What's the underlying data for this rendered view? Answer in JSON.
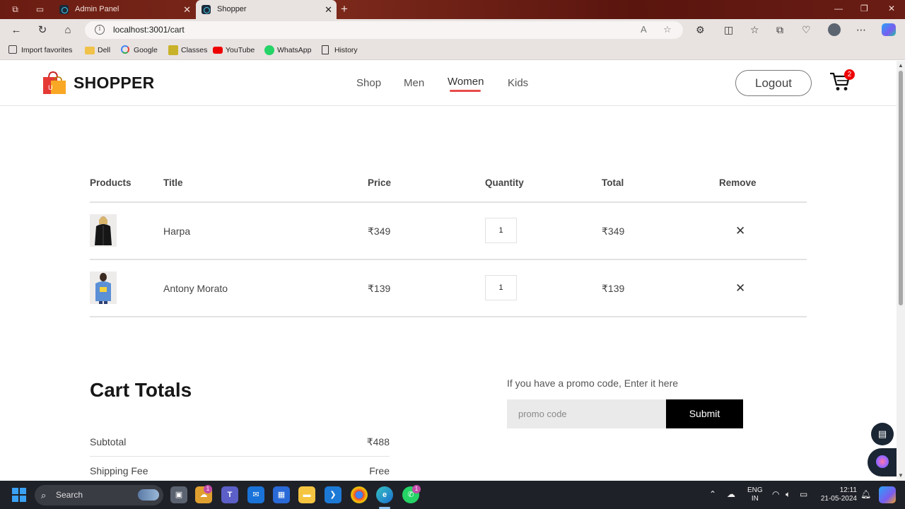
{
  "browser": {
    "tabs": [
      {
        "label": "Admin Panel",
        "active": false
      },
      {
        "label": "Shopper",
        "active": true
      }
    ],
    "url": "localhost:3001/cart",
    "bookmarks": [
      "Import favorites",
      "Dell",
      "Google",
      "Classes",
      "YouTube",
      "WhatsApp",
      "History"
    ]
  },
  "site": {
    "brand": "SHOPPER",
    "menu": [
      "Shop",
      "Men",
      "Women",
      "Kids"
    ],
    "active_menu": "Women",
    "logout_label": "Logout",
    "cart_count": "2"
  },
  "cart": {
    "headers": [
      "Products",
      "Title",
      "Price",
      "Quantity",
      "Total",
      "Remove"
    ],
    "items": [
      {
        "title": "Harpa",
        "price": "₹349",
        "quantity": "1",
        "total": "₹349"
      },
      {
        "title": "Antony Morato",
        "price": "₹139",
        "quantity": "1",
        "total": "₹139"
      }
    ]
  },
  "totals": {
    "title": "Cart Totals",
    "rows": [
      {
        "label": "Subtotal",
        "value": "₹488"
      },
      {
        "label": "Shipping Fee",
        "value": "Free"
      }
    ]
  },
  "promo": {
    "label": "If you have a promo code, Enter it here",
    "placeholder": "promo code",
    "submit_label": "Submit"
  },
  "taskbar": {
    "search_label": "Search",
    "notifications_teams": "1",
    "notifications_whatsapp": "1",
    "lang_top": "ENG",
    "lang_bottom": "IN",
    "time": "12:11",
    "date": "21-05-2024"
  }
}
